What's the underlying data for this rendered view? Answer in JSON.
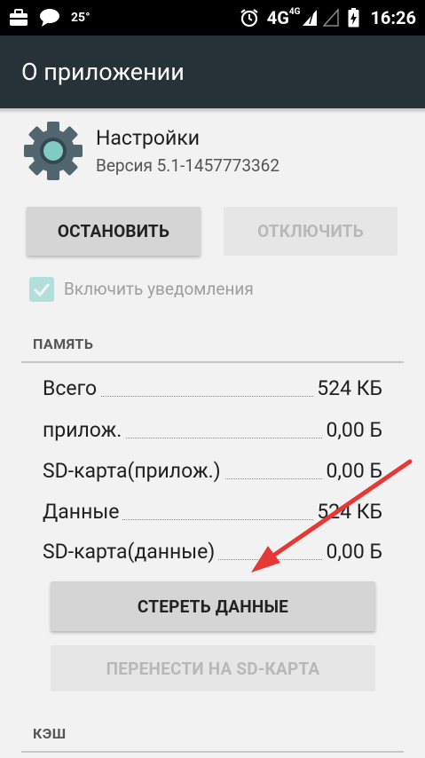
{
  "status_bar": {
    "temperature": "25°",
    "network": "4G",
    "network_small": "4G",
    "time": "16:26",
    "icons": [
      "briefcase-icon",
      "chat-bubble-icon",
      "alarm-icon",
      "signal-icon",
      "battery-charging-icon"
    ]
  },
  "app_bar": {
    "title": "О приложении"
  },
  "app_info": {
    "name": "Настройки",
    "version": "Версия 5.1-1457773362",
    "icon": "settings-gear-icon"
  },
  "buttons": {
    "stop": "ОСТАНОВИТЬ",
    "disable": "ОТКЛЮЧИТЬ",
    "clear_data": "СТЕРЕТЬ ДАННЫЕ",
    "move_to_sd": "ПЕРЕНЕСТИ НА SD-КАРТА"
  },
  "notifications": {
    "label": "Включить уведомления",
    "checked": true
  },
  "memory": {
    "header": "ПАМЯТЬ",
    "rows": [
      {
        "label": "Всего",
        "value": "524 КБ"
      },
      {
        "label": "прилож.",
        "value": "0,00 Б"
      },
      {
        "label": "SD-карта(прилож.)",
        "value": "0,00 Б"
      },
      {
        "label": "Данные",
        "value": "524 КБ"
      },
      {
        "label": "SD-карта(данные)",
        "value": "0,00 Б"
      }
    ]
  },
  "cache": {
    "header": "КЭШ"
  },
  "colors": {
    "app_bar": "#263238",
    "status_bar": "#000000",
    "accent_teal": "#80cbc4",
    "arrow_red": "#e53935"
  }
}
